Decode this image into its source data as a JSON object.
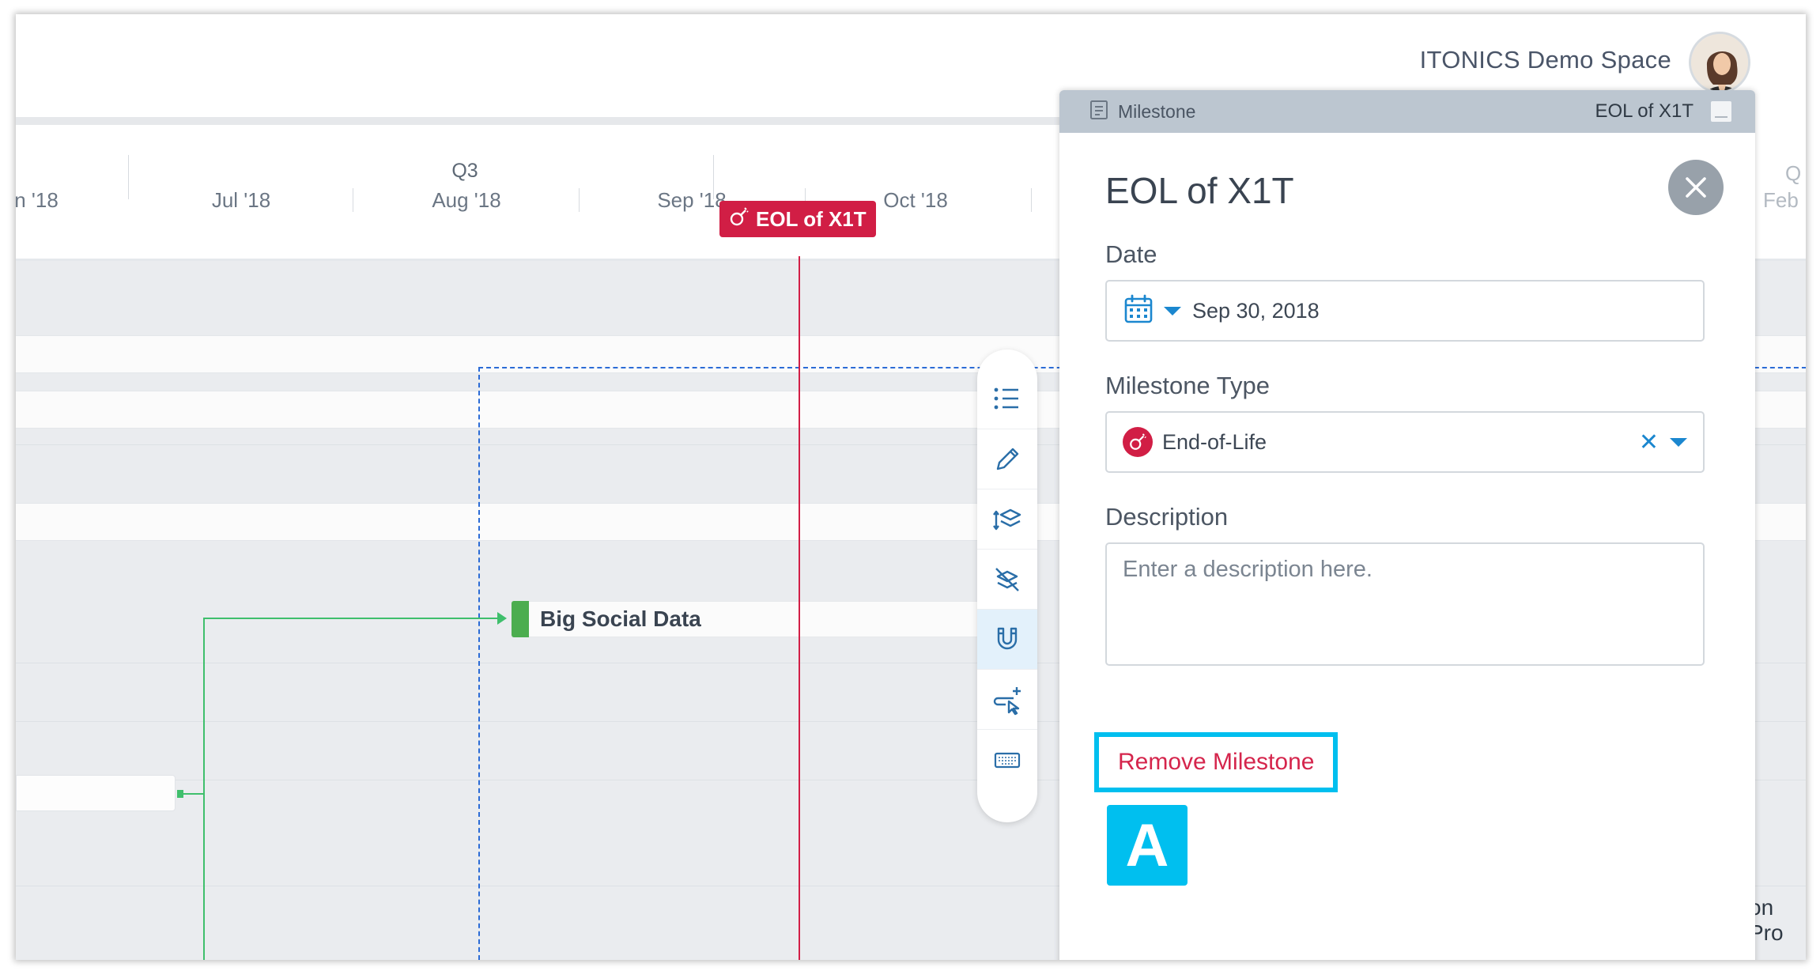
{
  "header": {
    "space_name": "ITONICS Demo Space"
  },
  "timeline": {
    "quarter": "Q3",
    "months": [
      "n '18",
      "Jul '18",
      "Aug '18",
      "Sep '18",
      "Oct '18"
    ],
    "right_quarter_peek": "Q",
    "right_month_peek": "Feb"
  },
  "milestone_tag": {
    "label": "EOL of X1T",
    "icon": "end-of-life-icon",
    "color": "#d11e45"
  },
  "roadmap_items": [
    {
      "label": "Big Social Data",
      "color": "#4cad4f"
    }
  ],
  "right_peek_text": "on Pro",
  "toolbar": {
    "tools": [
      "list-icon",
      "pencil-icon",
      "layers-up-icon",
      "layers-off-icon",
      "magnet-icon",
      "add-cursor-icon",
      "keyboard-icon"
    ],
    "active": "magnet-icon"
  },
  "panel": {
    "kind": "Milestone",
    "name": "EOL of X1T",
    "title": "EOL of X1T",
    "date_label": "Date",
    "date_value": "Sep 30, 2018",
    "type_label": "Milestone Type",
    "type_value": "End-of-Life",
    "description_label": "Description",
    "description_placeholder": "Enter a description here.",
    "remove_label": "Remove Milestone"
  },
  "annotation": {
    "badge": "A",
    "color": "#00bfef"
  }
}
